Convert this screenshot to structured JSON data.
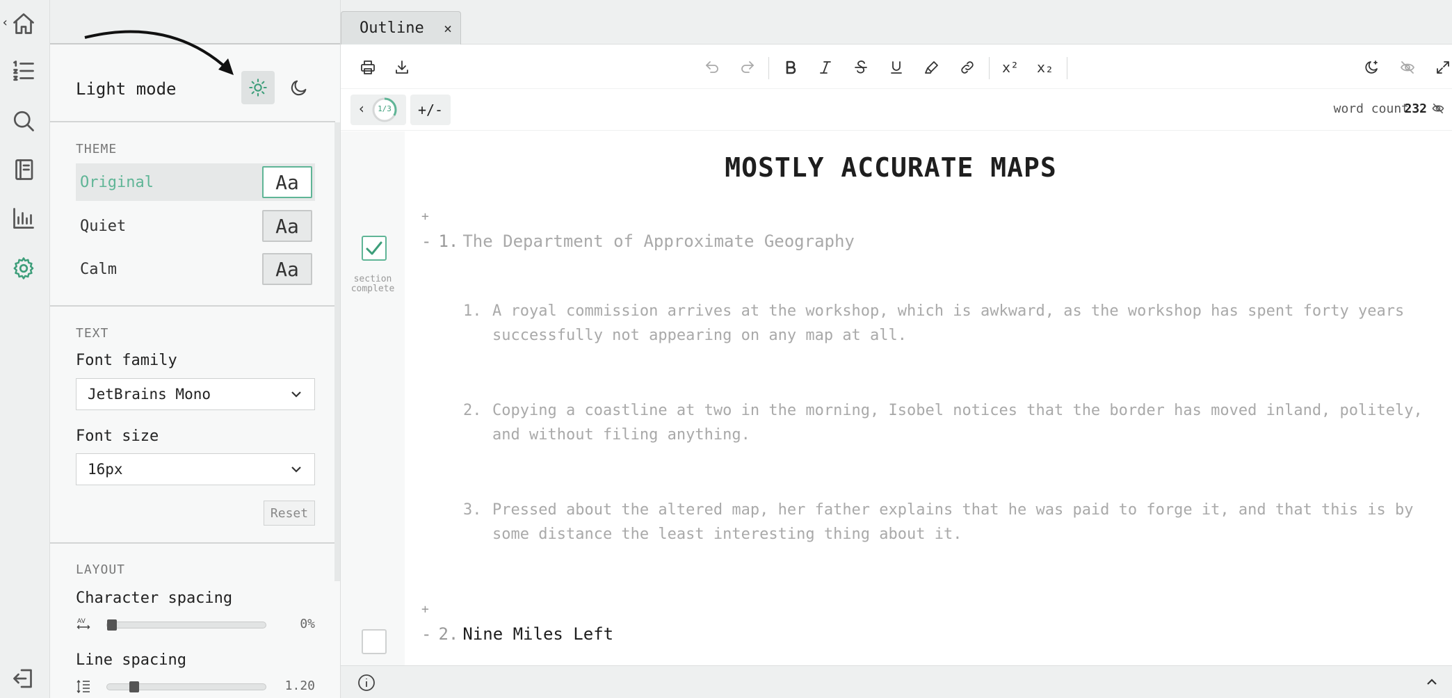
{
  "rail": {
    "collapse_glyph": "‹",
    "items": [
      {
        "icon": "home-icon"
      },
      {
        "icon": "list-icon"
      },
      {
        "icon": "search-icon"
      },
      {
        "icon": "notebook-icon"
      },
      {
        "icon": "stats-icon"
      },
      {
        "icon": "gear-icon",
        "active": true
      },
      {
        "icon": "logout-icon"
      }
    ]
  },
  "settings": {
    "mode_label": "Light mode",
    "theme_head": "THEME",
    "themes": [
      {
        "name": "Original",
        "sample": "Aa",
        "selected": true
      },
      {
        "name": "Quiet",
        "sample": "Aa"
      },
      {
        "name": "Calm",
        "sample": "Aa"
      }
    ],
    "text_head": "TEXT",
    "font_family_label": "Font family",
    "font_family_value": "JetBrains Mono",
    "font_size_label": "Font size",
    "font_size_value": "16px",
    "reset_label": "Reset",
    "layout_head": "LAYOUT",
    "char_spacing_label": "Character spacing",
    "char_spacing_value": "0%",
    "char_spacing_level": 0.0,
    "line_spacing_label": "Line spacing",
    "line_spacing_value": "1.20",
    "line_spacing_level": 0.15
  },
  "tab": {
    "label": "Outline",
    "close": "×"
  },
  "toolbar": {
    "superscript": "x²",
    "subscript": "x₂"
  },
  "subbar": {
    "prev": "‹",
    "progress": "1/3",
    "progress_fraction": 0.3333,
    "plusminus": "+/-",
    "word_count_label": "word count",
    "word_count": "232"
  },
  "doc": {
    "title": "MOSTLY ACCURATE MAPS",
    "add": "+",
    "dash": "-",
    "section_caption": "section complete",
    "sections": [
      {
        "num": "1.",
        "title": "The Department of Approximate Geography",
        "complete": true,
        "items": [
          {
            "num": "1.",
            "text": "A royal commission arrives at the workshop, which is awkward, as the workshop has spent forty years successfully not appearing on any map at all."
          },
          {
            "num": "2.",
            "text": "Copying a coastline at two in the morning, Isobel notices that the border has moved inland, politely, and without filing anything."
          },
          {
            "num": "3.",
            "text": "Pressed about the altered map, her father explains that he was paid to forge it, and that this is by some distance the least interesting thing about it."
          }
        ]
      },
      {
        "num": "2.",
        "title": "Nine Miles Left",
        "complete": false,
        "items": []
      }
    ]
  },
  "colors": {
    "accent": "#3d9e7a",
    "accent_light": "#5fb596",
    "muted_text": "#a9a9a9"
  }
}
